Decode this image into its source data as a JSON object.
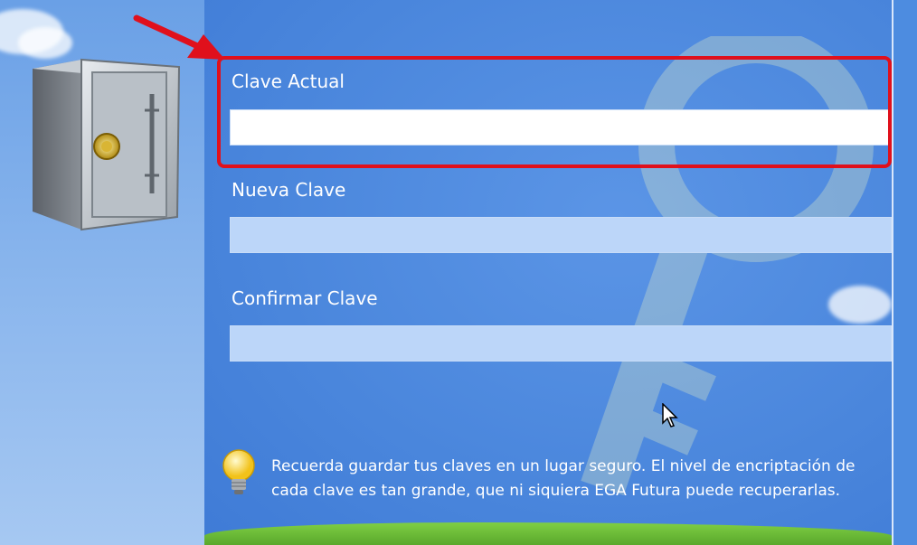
{
  "form": {
    "current_label": "Clave Actual",
    "current_value": "",
    "new_label": "Nueva Clave",
    "new_value": "",
    "confirm_label": "Confirmar Clave",
    "confirm_value": ""
  },
  "note": {
    "text": "Recuerda guardar tus claves en un lugar seguro. El nivel de encriptación de cada clave es tan grande, que ni siquiera EGA Futura puede recuperarlas."
  },
  "colors": {
    "background": "#4f8ddf",
    "highlight": "#e0101c",
    "input_disabled": "#bcd6f9",
    "text": "#ffffff"
  },
  "icons": [
    "safe-icon",
    "key-watermark-icon",
    "lightbulb-icon",
    "arrow-annotation-icon",
    "mouse-cursor-icon"
  ]
}
